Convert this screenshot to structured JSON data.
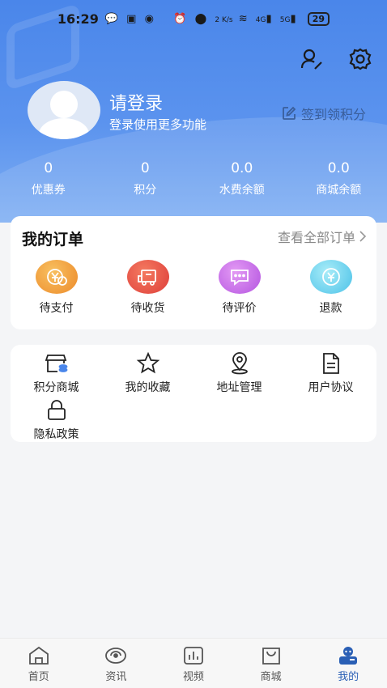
{
  "status_bar": {
    "time": "16:29",
    "network_speed": "2 K/s",
    "signal_4g": "4G",
    "signal_5g": "5G",
    "battery": "29"
  },
  "header": {
    "login_title": "请登录",
    "login_subtitle": "登录使用更多功能",
    "checkin_label": "签到领积分",
    "stats": [
      {
        "value": "0",
        "label": "优惠券"
      },
      {
        "value": "0",
        "label": "积分"
      },
      {
        "value": "0.0",
        "label": "水费余额"
      },
      {
        "value": "0.0",
        "label": "商城余额"
      }
    ]
  },
  "orders": {
    "title": "我的订单",
    "view_all": "查看全部订单",
    "items": [
      {
        "label": "待支付",
        "icon": "pending-payment-icon",
        "color": "#f0a038"
      },
      {
        "label": "待收货",
        "icon": "pending-delivery-icon",
        "color": "#ee5a48"
      },
      {
        "label": "待评价",
        "icon": "pending-review-icon",
        "color": "#c86ee8"
      },
      {
        "label": "退款",
        "icon": "refund-icon",
        "color": "#6fd0ee"
      }
    ]
  },
  "tools": [
    {
      "label": "积分商城",
      "icon": "points-mall-icon"
    },
    {
      "label": "我的收藏",
      "icon": "star-icon"
    },
    {
      "label": "地址管理",
      "icon": "location-pin-icon"
    },
    {
      "label": "用户协议",
      "icon": "document-icon"
    },
    {
      "label": "隐私政策",
      "icon": "lock-icon"
    }
  ],
  "tabbar": [
    {
      "label": "首页",
      "icon": "home-icon"
    },
    {
      "label": "资讯",
      "icon": "eye-icon"
    },
    {
      "label": "视频",
      "icon": "chart-icon"
    },
    {
      "label": "商城",
      "icon": "shopping-bag-icon"
    },
    {
      "label": "我的",
      "icon": "profile-icon",
      "active": true
    }
  ],
  "colors": {
    "header_blue": "#4a86ea",
    "accent": "#2a5fb5"
  }
}
